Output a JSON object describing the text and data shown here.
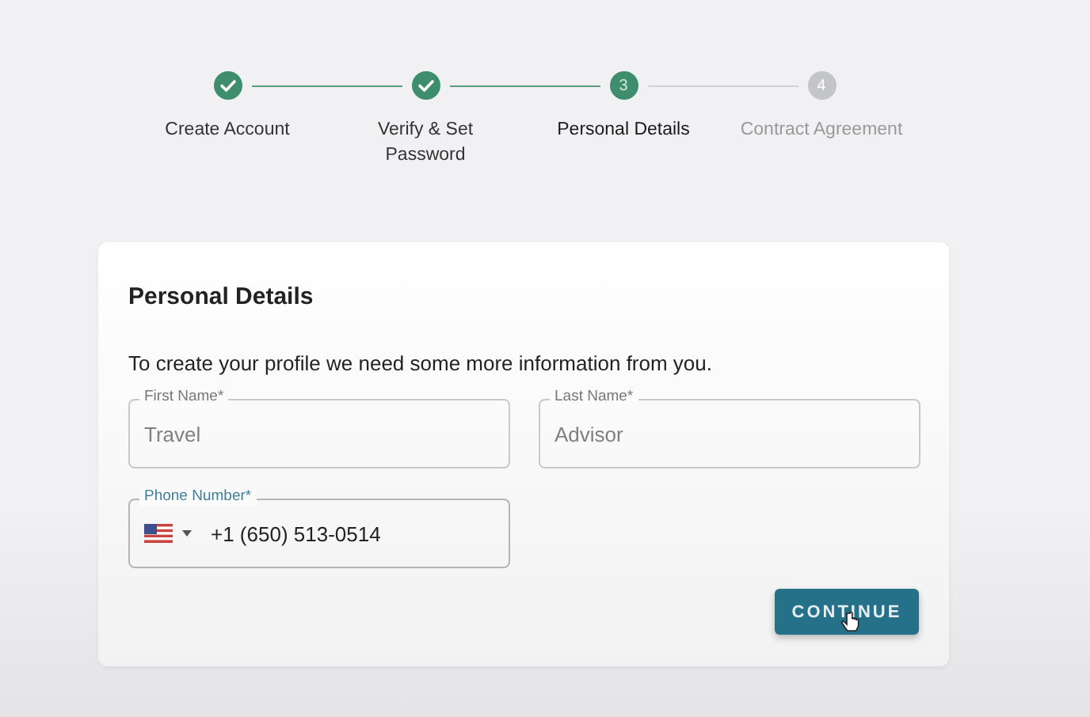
{
  "steps": [
    {
      "label": "Create Account",
      "completed": true,
      "selected": false
    },
    {
      "label": "Verify & Set Password",
      "completed": true,
      "selected": false
    },
    {
      "label": "Personal Details",
      "completed": false,
      "selected": true,
      "number": "3"
    },
    {
      "label": "Contract Agreement",
      "completed": false,
      "selected": false,
      "number": "4"
    }
  ],
  "card": {
    "title": "Personal Details",
    "description": "To create your profile we need some more information from you.",
    "fields": [
      {
        "kind": "text",
        "label": "First Name*",
        "value": "Travel",
        "focused": false,
        "disabled": true
      },
      {
        "kind": "text",
        "label": "Last Name*",
        "value": "Advisor",
        "focused": false,
        "disabled": true
      },
      {
        "kind": "phone",
        "label": "Phone Number*",
        "value": "+1 (650) 513-0514",
        "focused": true,
        "disabled": false
      }
    ],
    "button": "CONTINUE"
  }
}
